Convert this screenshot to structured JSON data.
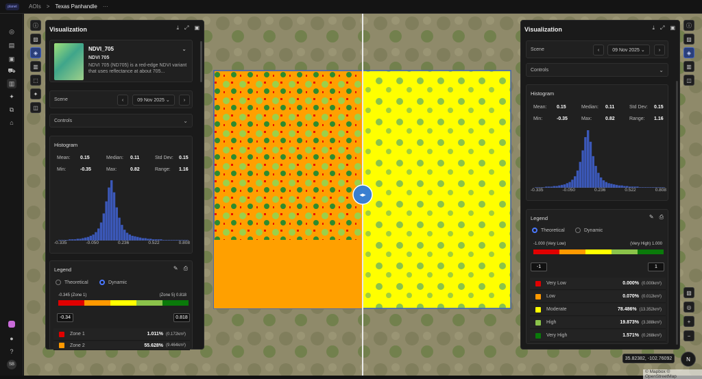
{
  "topbar": {
    "logo": "planet",
    "crumb_root": "AOIs",
    "crumb_sep": ">",
    "crumb_current": "Texas Panhandle",
    "more": "···"
  },
  "rail": {
    "items": [
      "compass-icon",
      "layers-icon",
      "car-icon",
      "cart-icon",
      "map-icon",
      "analytics-icon",
      "graph-icon",
      "store-icon"
    ],
    "avatar": "SB"
  },
  "left": {
    "title": "Visualization",
    "layer": {
      "name": "NDVI_705",
      "subtitle": "NDVI 705",
      "desc": "NDVI 705 (ND705) is a red-edge NDVI variant that uses reflectance at about 705..."
    },
    "scene_label": "Scene",
    "scene_date": "09 Nov 2025",
    "controls": "Controls",
    "histogram": "Histogram",
    "stats": {
      "mean_l": "Mean:",
      "mean": "0.15",
      "median_l": "Median:",
      "median": "0.11",
      "std_l": "Std Dev:",
      "std": "0.15",
      "min_l": "Min:",
      "min": "-0.35",
      "max_l": "Max:",
      "max": "0.82",
      "range_l": "Range:",
      "range": "1.16"
    },
    "ticks": [
      "-0.335",
      "-0.050",
      "0.236",
      "0.522",
      "0.808"
    ],
    "legend": "Legend",
    "mode_a": "Theoretical",
    "mode_b": "Dynamic",
    "scale_lo": "-0.345 (Zone 1)",
    "scale_hi": "(Zone 5) 0.818",
    "in_lo": "-0.34",
    "in_hi": "0.818",
    "zones": [
      {
        "name": "Zone 1",
        "pct": "1.011%",
        "area": "(0.172km²)",
        "color": "#e00000"
      },
      {
        "name": "Zone 2",
        "pct": "55.628%",
        "area": "(9.464km²)",
        "color": "#ff9900"
      }
    ]
  },
  "right": {
    "title": "Visualization",
    "scene_label": "Scene",
    "scene_date": "09 Nov 2025",
    "controls": "Controls",
    "histogram": "Histogram",
    "stats": {
      "mean_l": "Mean:",
      "mean": "0.15",
      "median_l": "Median:",
      "median": "0.11",
      "std_l": "Std Dev:",
      "std": "0.15",
      "min_l": "Min:",
      "min": "-0.35",
      "max_l": "Max:",
      "max": "0.82",
      "range_l": "Range:",
      "range": "1.16"
    },
    "ticks": [
      "-0.335",
      "-0.050",
      "0.236",
      "0.522",
      "0.808"
    ],
    "legend": "Legend",
    "mode_a": "Theoretical",
    "mode_b": "Dynamic",
    "scale_lo": "-1.000 (Very Low)",
    "scale_hi": "(Very High) 1.000",
    "in_lo": "-1",
    "in_hi": "1",
    "classes": [
      {
        "name": "Very Low",
        "pct": "0.000%",
        "area": "(0.000km²)",
        "color": "#e00000"
      },
      {
        "name": "Low",
        "pct": "0.070%",
        "area": "(0.012km²)",
        "color": "#ff9900"
      },
      {
        "name": "Moderate",
        "pct": "78.486%",
        "area": "(13.352km²)",
        "color": "#ffff00"
      },
      {
        "name": "High",
        "pct": "19.873%",
        "area": "(3.388km²)",
        "color": "#8bc34a"
      },
      {
        "name": "Very High",
        "pct": "1.571%",
        "area": "(0.268km²)",
        "color": "#0a7a0a"
      }
    ]
  },
  "map": {
    "coords": "35.82382, -102.76092",
    "attribution": "© Mapbox © OpenStreetMap",
    "compass": "N"
  },
  "hist_values": [
    1,
    1,
    1,
    1,
    2,
    2,
    2,
    3,
    3,
    4,
    5,
    6,
    8,
    10,
    14,
    20,
    30,
    45,
    65,
    88,
    100,
    80,
    55,
    38,
    26,
    18,
    13,
    10,
    8,
    7,
    6,
    5,
    4,
    4,
    3,
    3,
    2,
    2,
    2,
    2,
    1,
    1,
    1,
    1,
    1,
    1,
    1,
    1,
    1,
    1
  ]
}
